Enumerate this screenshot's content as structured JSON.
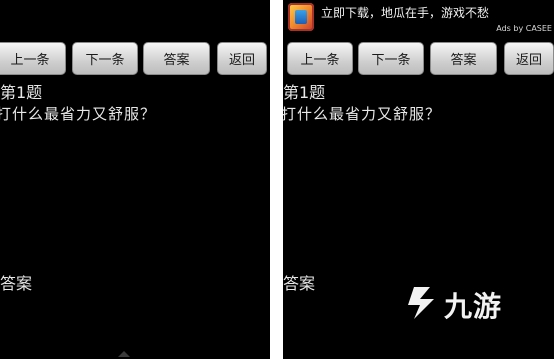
{
  "left_screen": {
    "buttons": {
      "prev": "上一条",
      "next": "下一条",
      "answer": "答案",
      "back": "返回"
    },
    "question_number": "第1题",
    "question_text": "打什么最省力又舒服？",
    "answer_label": "答案"
  },
  "right_screen": {
    "ad": {
      "text": "立即下载，地瓜在手，游戏不愁",
      "credit": "Ads by CASEE"
    },
    "buttons": {
      "prev": "上一条",
      "next": "下一条",
      "answer": "答案",
      "back": "返回"
    },
    "question_number": "第1题",
    "question_text": "打什么最省力又舒服？",
    "answer_label": "答案"
  },
  "watermark": {
    "text": "九游"
  }
}
